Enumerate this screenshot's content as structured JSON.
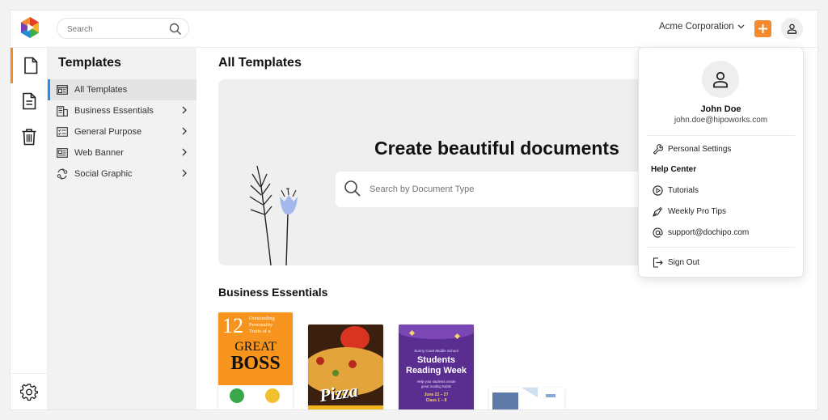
{
  "topbar": {
    "search_placeholder": "Search",
    "org_name": "Acme Corporation"
  },
  "sidebar": {
    "title": "Templates",
    "items": [
      {
        "label": "All Templates",
        "icon": "layout-icon",
        "active": true
      },
      {
        "label": "Business Essentials",
        "icon": "building-icon"
      },
      {
        "label": "General Purpose",
        "icon": "checklist-icon"
      },
      {
        "label": "Web Banner",
        "icon": "banner-icon"
      },
      {
        "label": "Social Graphic",
        "icon": "social-icon"
      }
    ]
  },
  "main": {
    "title": "All Templates",
    "hero_title": "Create beautiful documents",
    "hero_search_placeholder": "Search by Document Type",
    "section_title": "Business Essentials"
  },
  "cards": {
    "boss": {
      "number": "12",
      "line1": "Outstanding",
      "line2": "Personality",
      "line3": "Traits of a",
      "word1": "GREAT",
      "word2": "BOSS"
    },
    "pizza": {
      "word": "Pizza"
    },
    "reading": {
      "school": "Sunny Court Middle School",
      "title1": "Students",
      "title2": "Reading Week",
      "sub1": "Help your students create",
      "sub2": "great reading habits",
      "dates": "June 22 – 27",
      "classes": "Class 1 – 8"
    }
  },
  "dropdown": {
    "name": "John Doe",
    "email": "john.doe@hipoworks.com",
    "personal_settings": "Personal Settings",
    "help_center": "Help Center",
    "tutorials": "Tutorials",
    "weekly_tips": "Weekly Pro Tips",
    "support": "support@dochipo.com",
    "sign_out": "Sign Out"
  },
  "colors": {
    "accent": "#f38a2e",
    "active_blue": "#2a8cf0"
  }
}
